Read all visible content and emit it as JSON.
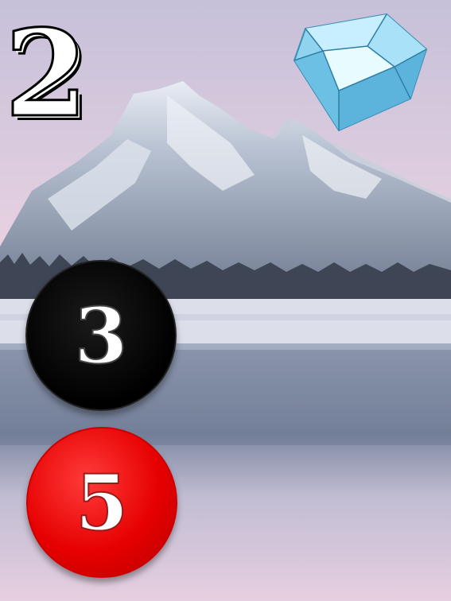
{
  "items": {
    "top_number": "2",
    "black_chip": "3",
    "red_chip": "5",
    "diamond": "diamond-icon"
  },
  "colors": {
    "black_chip": "#000000",
    "red_chip": "#e60000",
    "diamond": "#8fd3ef"
  }
}
